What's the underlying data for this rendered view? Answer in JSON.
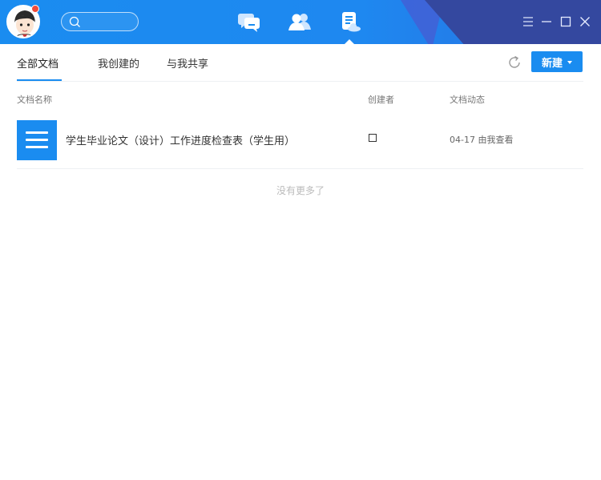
{
  "nav": {
    "search": {
      "placeholder": ""
    },
    "icons": [
      "chat-icon",
      "contacts-icon",
      "documents-icon"
    ],
    "active": "documents-icon"
  },
  "window_controls": [
    "menu-icon",
    "minimize-icon",
    "maximize-icon",
    "close-icon"
  ],
  "tabs": [
    {
      "label": "全部文档",
      "active": true
    },
    {
      "label": "我创建的",
      "active": false
    },
    {
      "label": "与我共享",
      "active": false
    }
  ],
  "toolbar": {
    "new_label": "新建"
  },
  "table": {
    "columns": [
      "文档名称",
      "创建者",
      "文档动态"
    ],
    "rows": [
      {
        "name": "学生毕业论文（设计）工作进度检查表（学生用）",
        "creator": "",
        "activity": "04-17 由我查看"
      }
    ]
  },
  "footer": {
    "no_more": "没有更多了"
  },
  "colors": {
    "primary": "#1a8cf0",
    "titlebar_dark": "#34489f",
    "badge": "#f04a3a"
  }
}
